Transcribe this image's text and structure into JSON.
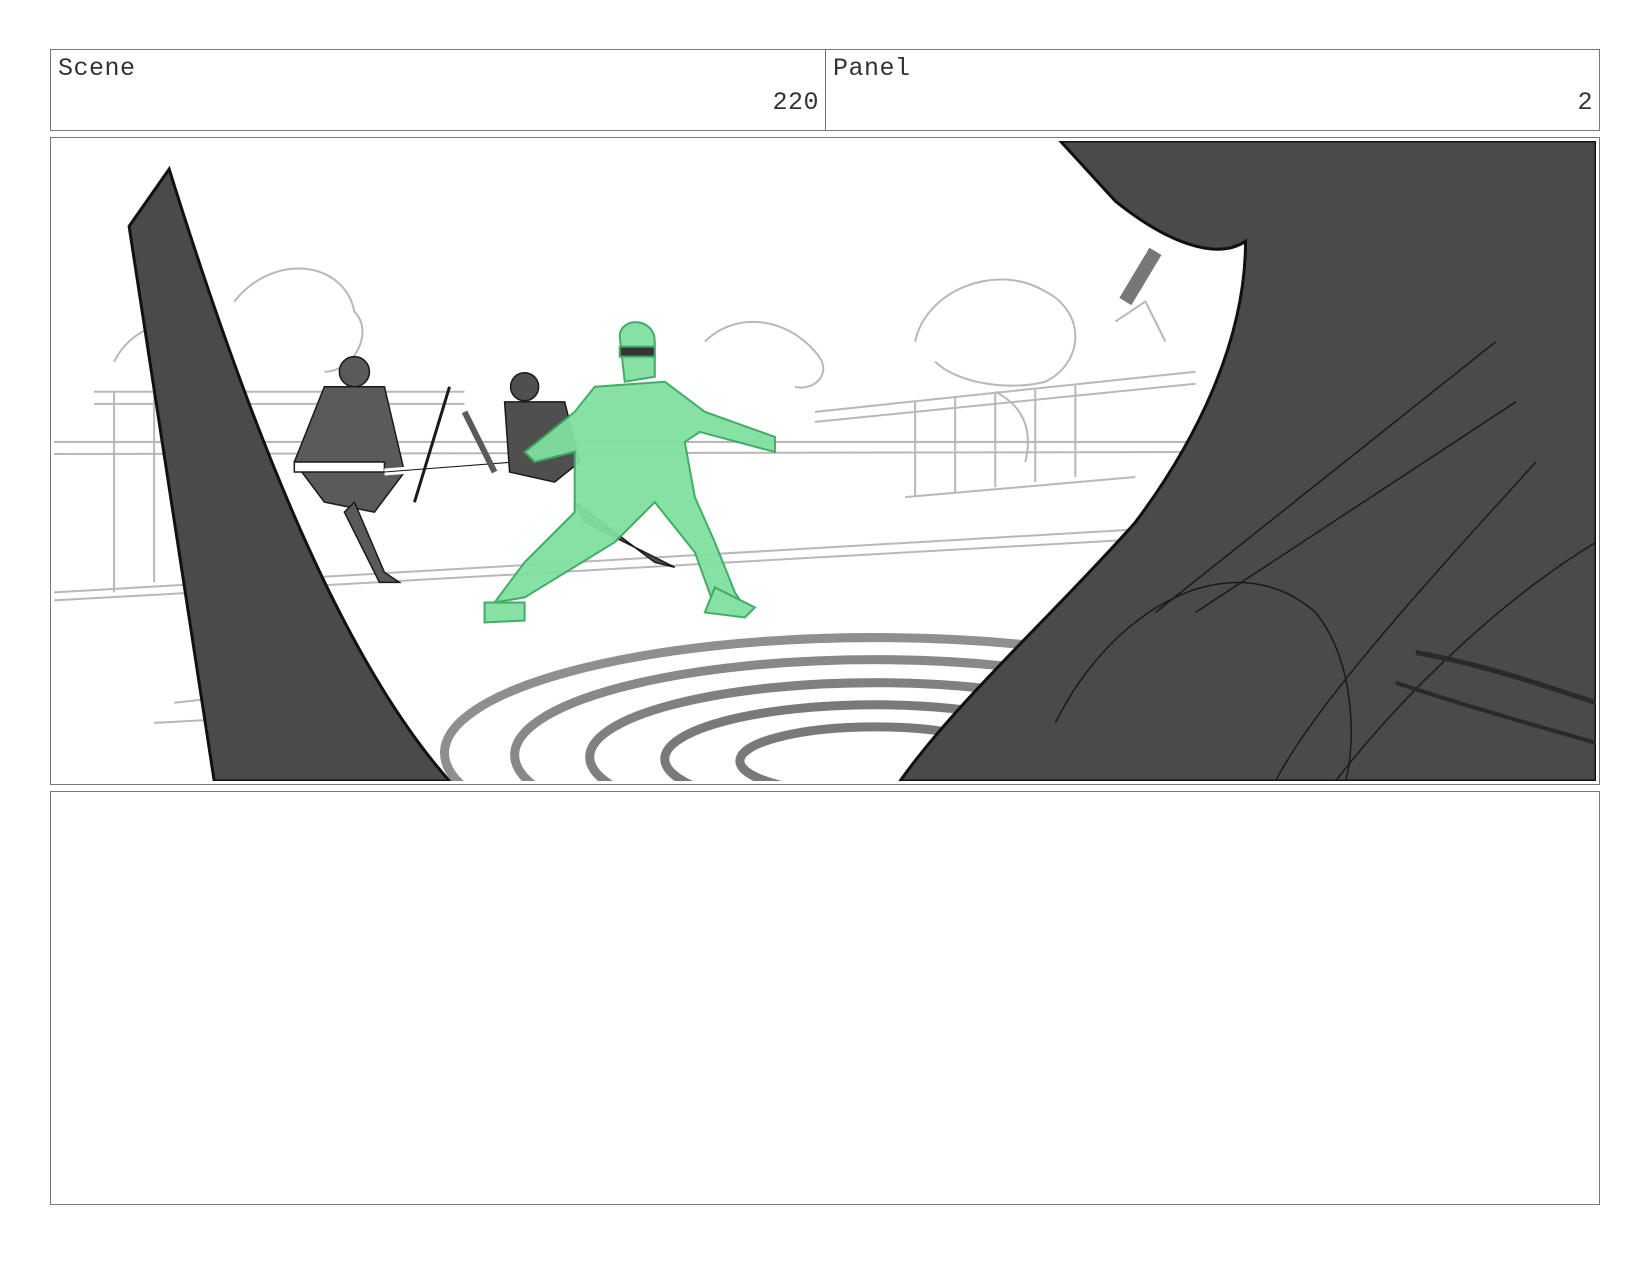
{
  "header": {
    "scene_label": "Scene",
    "scene_value": "220",
    "panel_label": "Panel",
    "panel_value": "2"
  },
  "frame": {
    "sketch_colors": {
      "dark_fill": "#4a4a4a",
      "line": "#1a1a1a",
      "light_line": "#b0b0b0",
      "highlight": "#7fe0a0",
      "highlight_line": "#3aa860"
    }
  },
  "notes": {
    "text": ""
  }
}
